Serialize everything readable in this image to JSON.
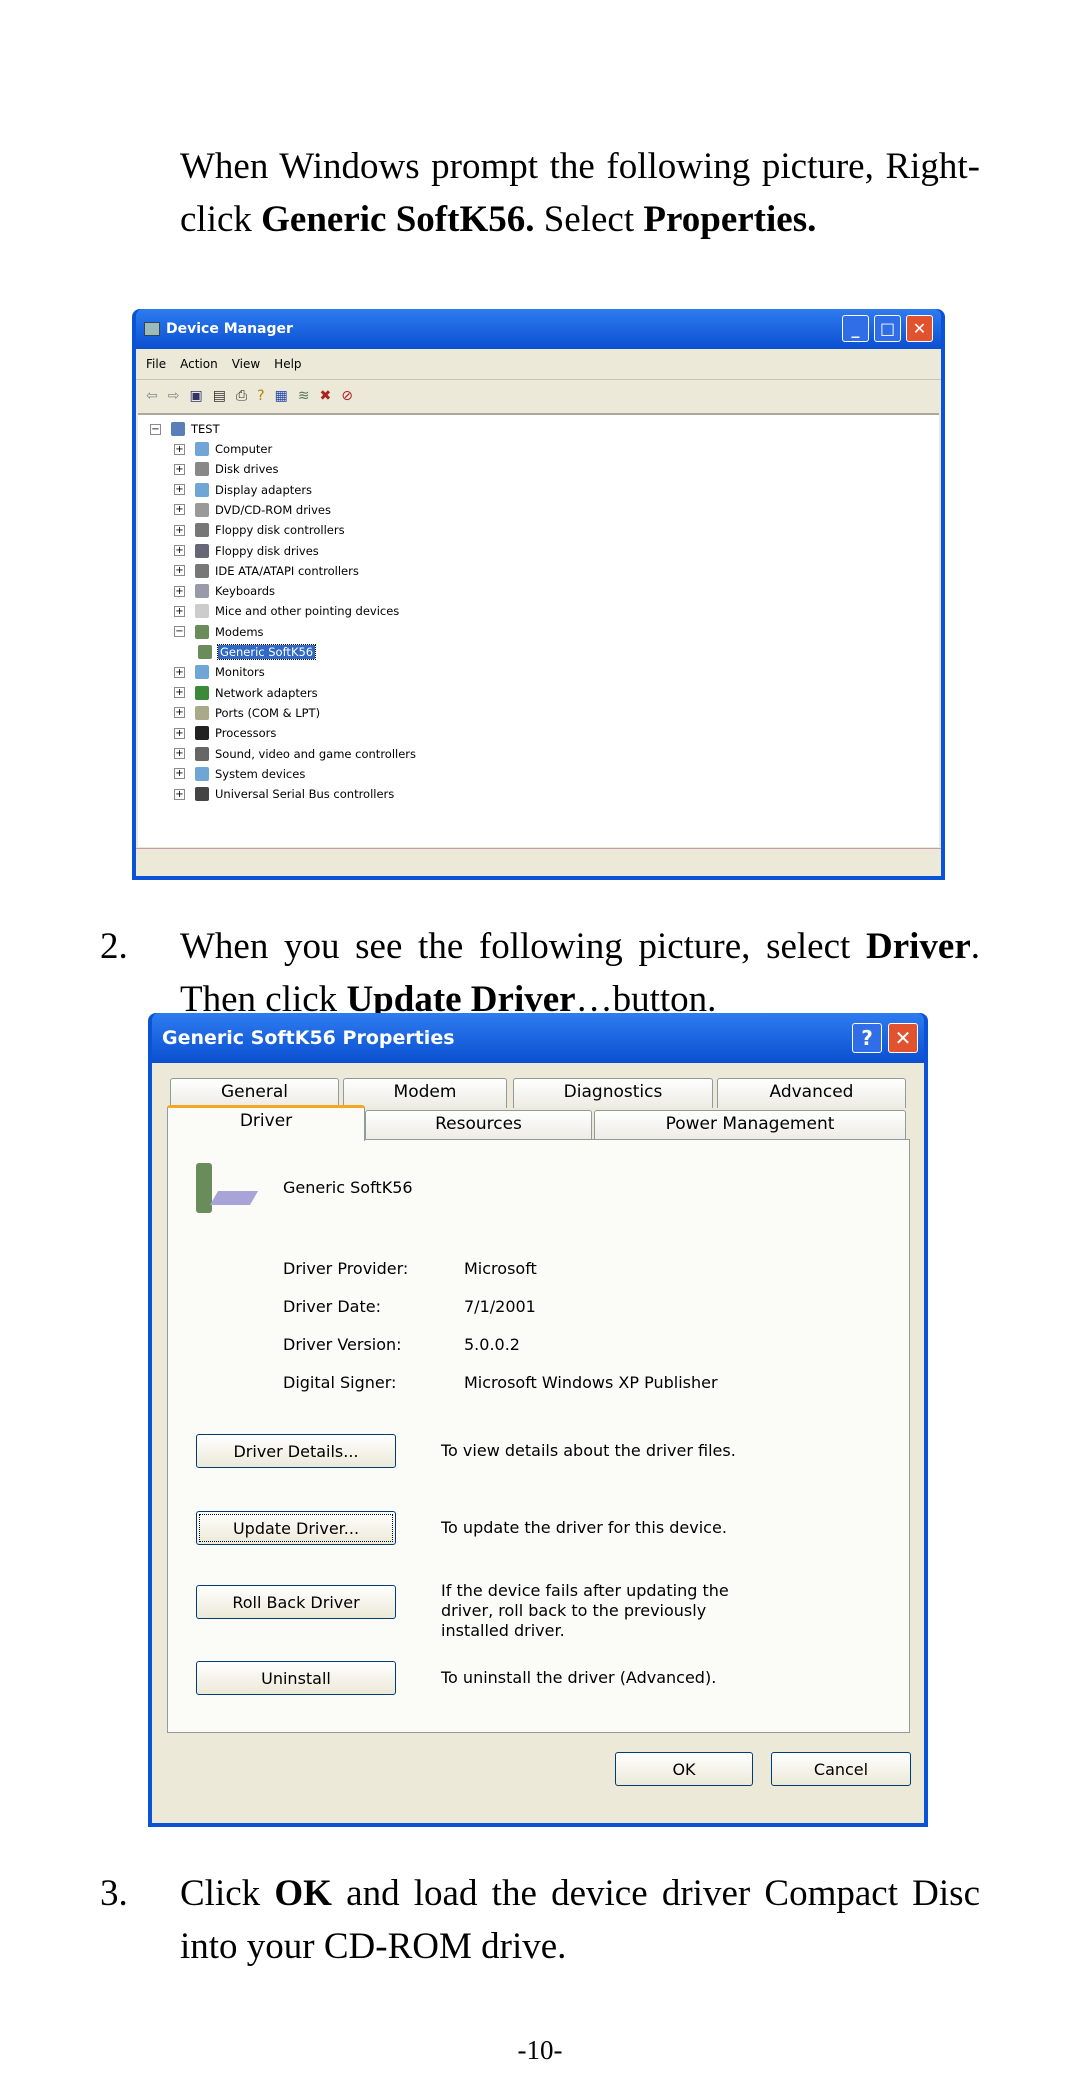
{
  "step1": {
    "text_a": "When Windows prompt the following picture, Right-click ",
    "bold_a": "Generic SoftK56.",
    "text_b": " Select ",
    "bold_b": "Properties."
  },
  "device_manager": {
    "title": "Device Manager",
    "menu": [
      "File",
      "Action",
      "View",
      "Help"
    ],
    "root": "TEST",
    "items": [
      "Computer",
      "Disk drives",
      "Display adapters",
      "DVD/CD-ROM drives",
      "Floppy disk controllers",
      "Floppy disk drives",
      "IDE ATA/ATAPI controllers",
      "Keyboards",
      "Mice and other pointing devices",
      "Modems",
      "Generic SoftK56",
      "Monitors",
      "Network adapters",
      "Ports (COM & LPT)",
      "Processors",
      "Sound, video and game controllers",
      "System devices",
      "Universal Serial Bus controllers"
    ],
    "selected": "Generic SoftK56"
  },
  "step2": {
    "number": "2.",
    "text_a": "When you see the following picture, select ",
    "bold_a": "Driver",
    "text_b": ". Then click ",
    "bold_b": "Update Driver",
    "text_c": "…button."
  },
  "properties": {
    "title": "Generic SoftK56 Properties",
    "tabs_row1": [
      "General",
      "Modem",
      "Diagnostics",
      "Advanced"
    ],
    "tabs_row2": [
      "Driver",
      "Resources",
      "Power Management"
    ],
    "device_name": "Generic SoftK56",
    "fields": [
      {
        "label": "Driver Provider:",
        "value": "Microsoft"
      },
      {
        "label": "Driver Date:",
        "value": "7/1/2001"
      },
      {
        "label": "Driver Version:",
        "value": "5.0.0.2"
      },
      {
        "label": "Digital Signer:",
        "value": "Microsoft Windows XP Publisher"
      }
    ],
    "buttons": [
      {
        "label": "Driver Details...",
        "desc": "To view details about the driver files."
      },
      {
        "label": "Update Driver...",
        "desc": "To update the driver for this device."
      },
      {
        "label": "Roll Back Driver",
        "desc": "If the device fails after updating the driver, roll back to the previously installed driver."
      },
      {
        "label": "Uninstall",
        "desc": "To uninstall the driver (Advanced)."
      }
    ],
    "ok": "OK",
    "cancel": "Cancel"
  },
  "step3": {
    "number": "3.",
    "text_a": "Click ",
    "bold_a": "OK",
    "text_b": " and load the device driver Compact Disc into your CD-ROM drive."
  },
  "page_number": "-10-"
}
